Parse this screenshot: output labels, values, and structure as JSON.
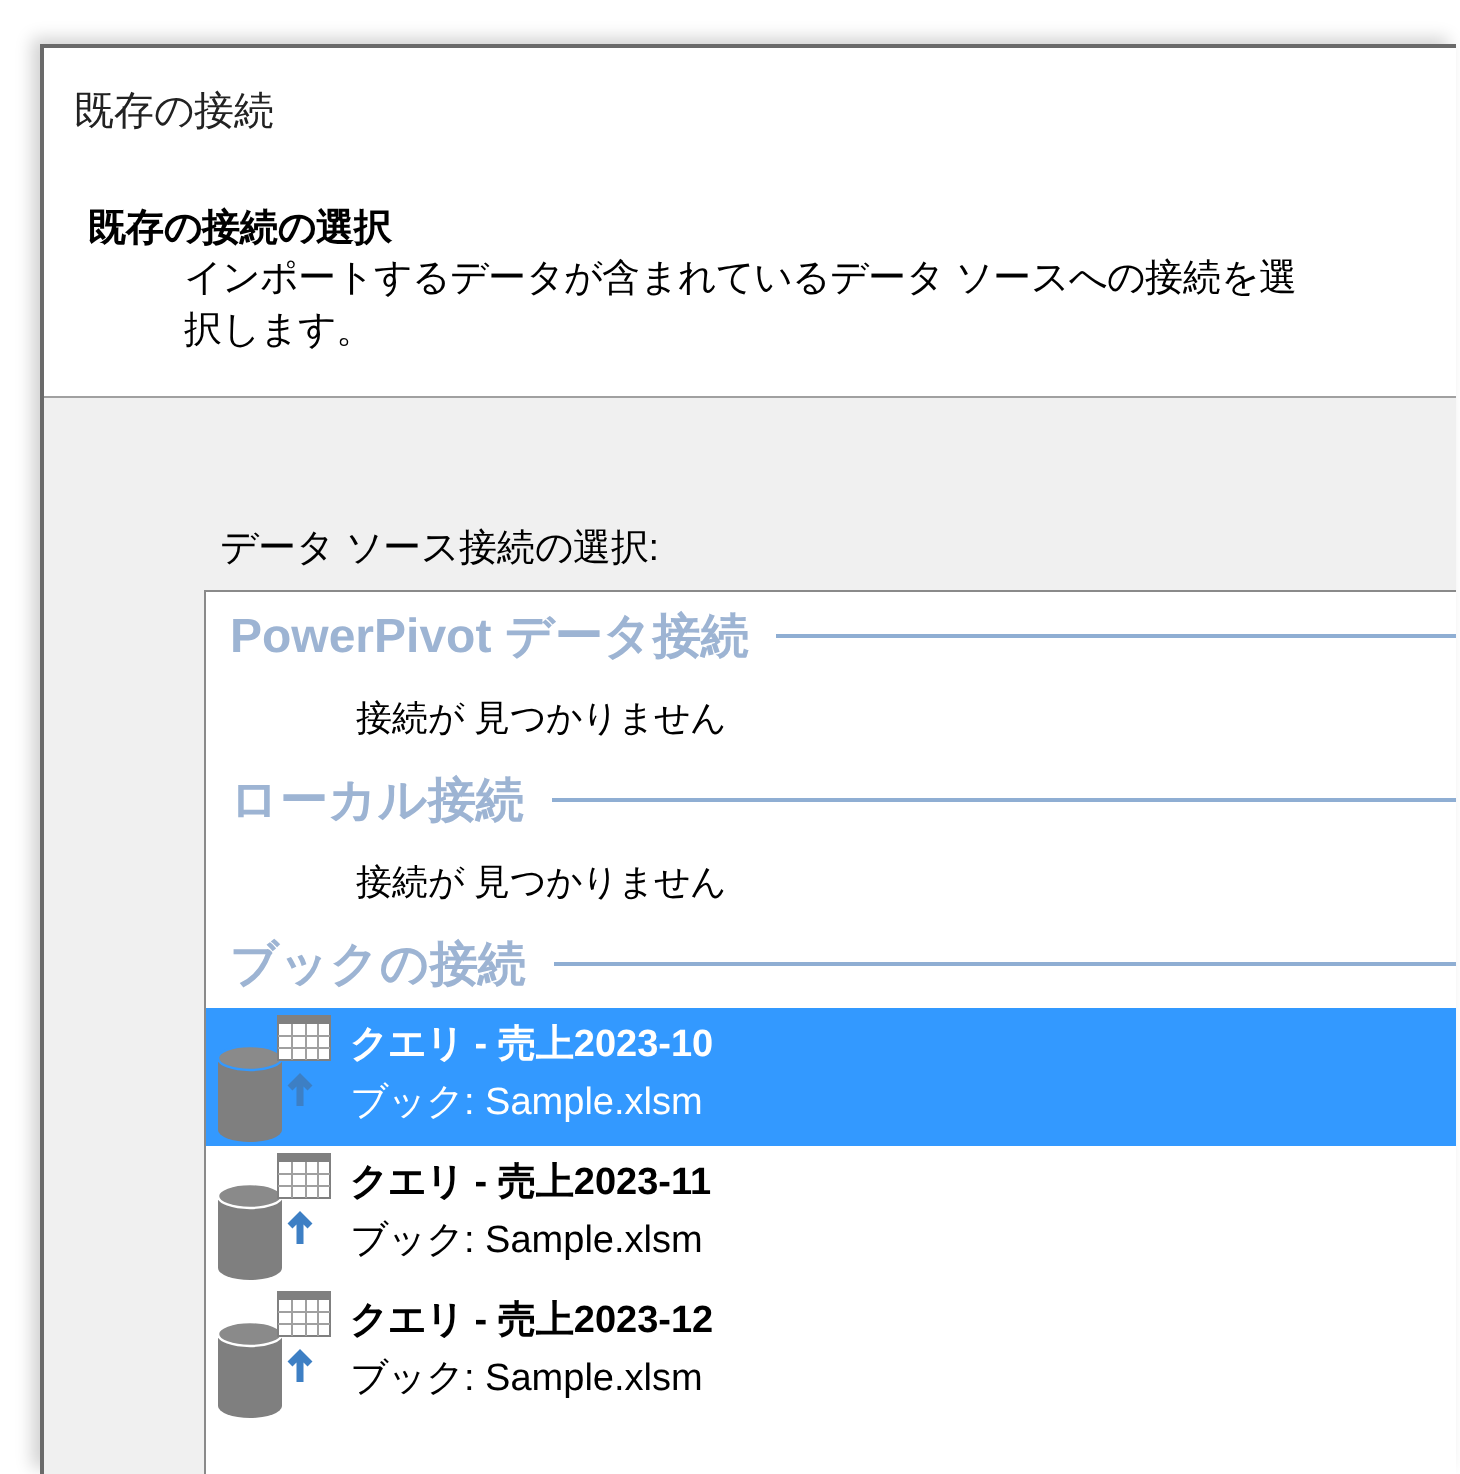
{
  "window": {
    "title": "既存の接続"
  },
  "header": {
    "title": "既存の接続の選択",
    "description": "インポートするデータが含まれているデータ ソースへの接続を選択します。"
  },
  "list_label": "データ ソース接続の選択:",
  "groups": [
    {
      "title": "PowerPivot データ接続",
      "empty_message": "接続が 見つかりません"
    },
    {
      "title": "ローカル接続",
      "empty_message": "接続が 見つかりません"
    },
    {
      "title": "ブックの接続",
      "connections": [
        {
          "name": "クエリ - 売上2023-10",
          "source": "ブック: Sample.xlsm",
          "selected": true
        },
        {
          "name": "クエリ - 売上2023-11",
          "source": "ブック: Sample.xlsm",
          "selected": false
        },
        {
          "name": "クエリ - 売上2023-12",
          "source": "ブック: Sample.xlsm",
          "selected": false
        }
      ]
    }
  ]
}
